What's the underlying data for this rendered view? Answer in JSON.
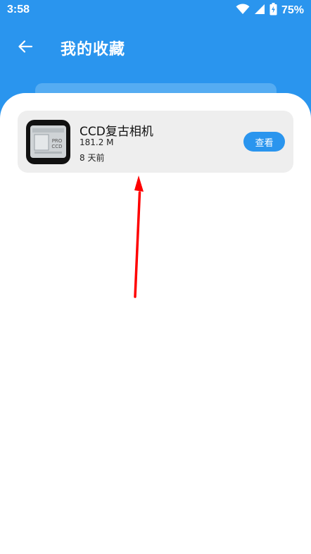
{
  "status_bar": {
    "time": "3:58",
    "battery_percent": "75%",
    "icons": [
      "wifi-icon",
      "signal-icon",
      "battery-charging-icon"
    ]
  },
  "header": {
    "title": "我的收藏",
    "back_icon": "back-arrow-icon"
  },
  "favorites": [
    {
      "name": "CCD复古相机",
      "size": "181.2 M",
      "time_ago": "8 天前",
      "action_label": "查看",
      "icon": "app-icon-ccd-camera",
      "icon_text_line1": "PRO",
      "icon_text_line2": "CCD"
    }
  ],
  "colors": {
    "primary": "#2a95ee",
    "card_bg": "#eeeeee",
    "annotation_arrow": "#ff0000"
  }
}
